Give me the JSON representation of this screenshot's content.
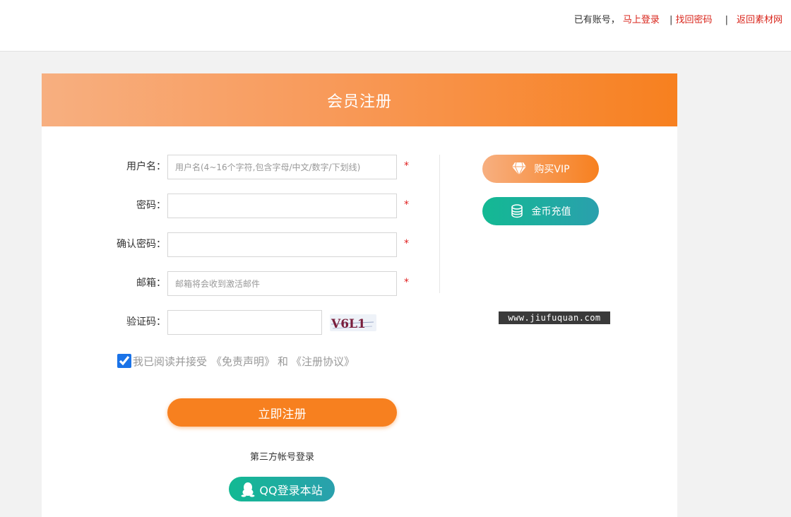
{
  "topbar": {
    "have_account": "已有账号，",
    "login_now": "马上登录",
    "sep1": "|",
    "retrieve_password": "找回密码",
    "sep2": "|",
    "back_link": "返回素材网"
  },
  "panel": {
    "title": "会员注册"
  },
  "form": {
    "username_label": "用户名：",
    "username_placeholder": "用户名(4~16个字符,包含字母/中文/数字/下划线)",
    "password_label": "密码：",
    "confirm_label": "确认密码：",
    "email_label": "邮箱：",
    "email_placeholder": "邮箱将会收到激活邮件",
    "captcha_label": "验证码：",
    "captcha_text": "V6L1",
    "required_mark": "*",
    "agree_text": "我已阅读并接受",
    "disclaimer_link": "《免责声明》",
    "and_text": "和",
    "agreement_link": "《注册协议》",
    "agree_checked": true,
    "submit_label": "立即注册",
    "third_party_label": "第三方帐号登录",
    "qq_login_label": "QQ登录本站"
  },
  "side": {
    "vip_label": "购买VIP",
    "recharge_label": "金币充值"
  },
  "watermark": "www.jiufuquan.com",
  "colors": {
    "accent_orange": "#f7801f",
    "accent_teal": "#13b993",
    "link_red": "#d9261c"
  }
}
